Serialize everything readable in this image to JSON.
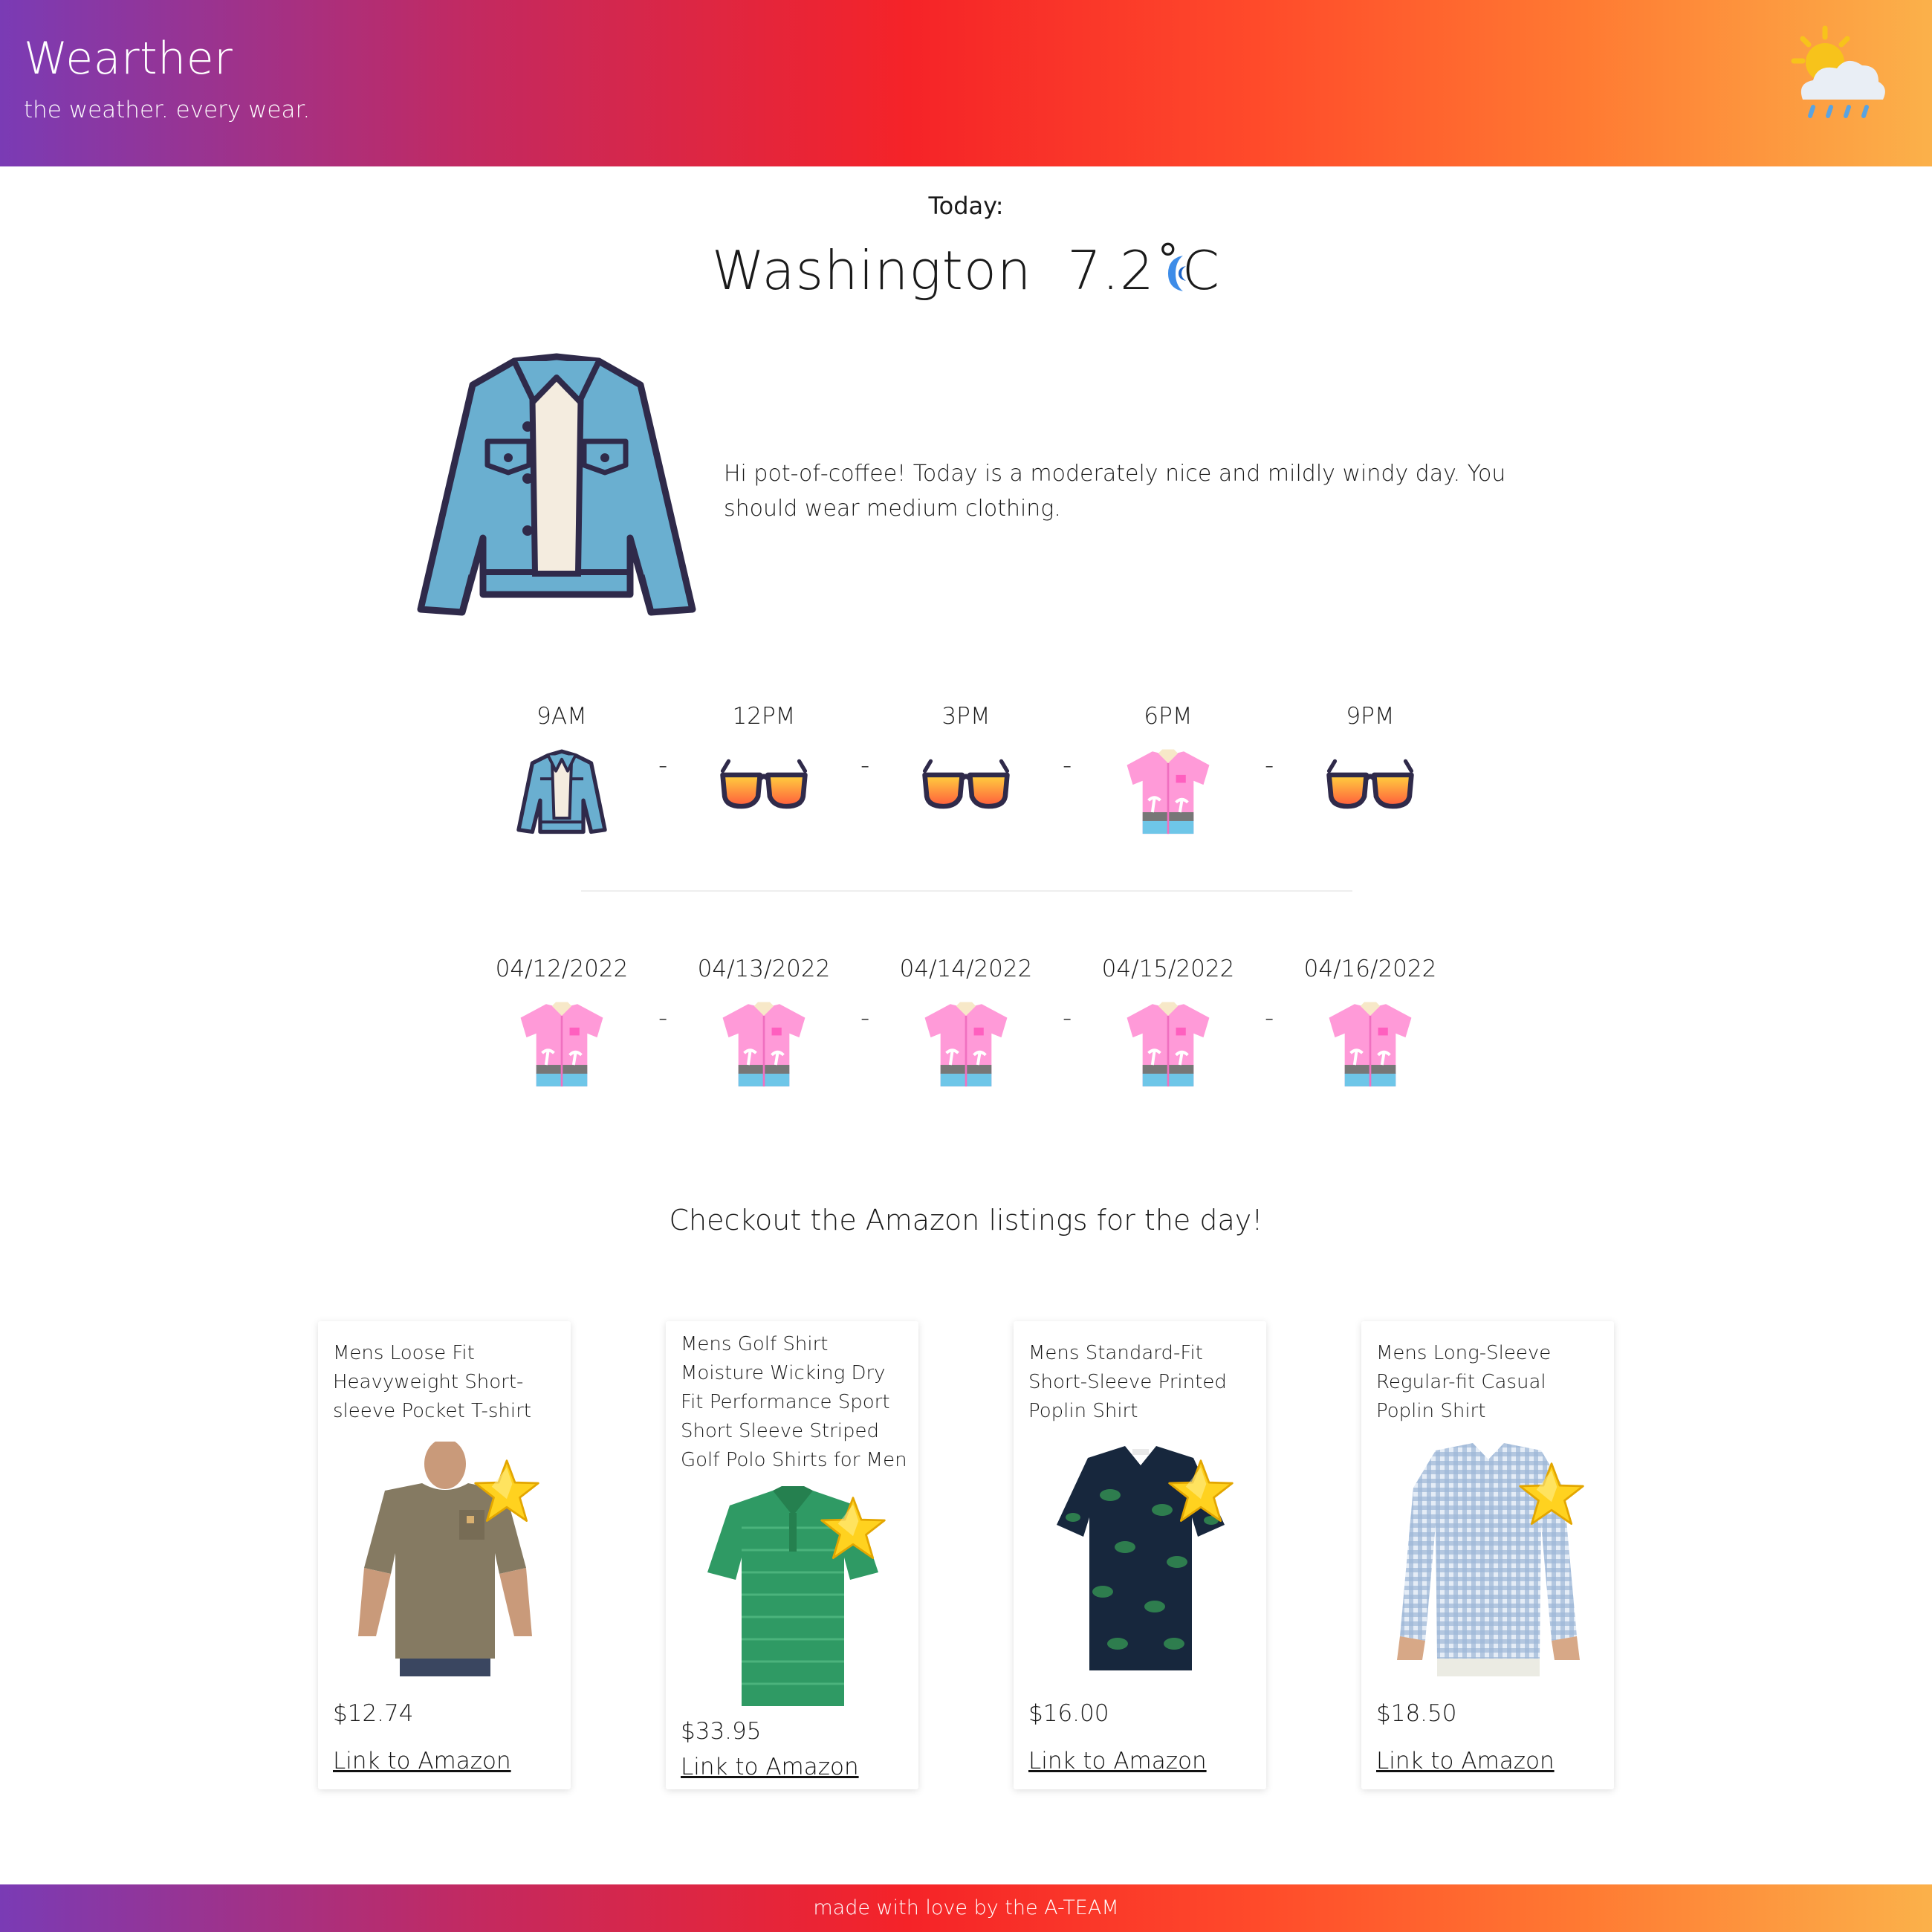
{
  "header": {
    "brand": "Wearther",
    "tagline": "the weather. every wear."
  },
  "today": {
    "label": "Today:",
    "city": "Washington",
    "temperature": "7.2˚C",
    "condition_icon": "moon-icon",
    "outfit_icon": "denim-jacket-icon",
    "message": "Hi pot-of-coffee! Today is a moderately nice and mildly windy day. You should wear medium clothing."
  },
  "hourly": [
    {
      "time": "9AM",
      "icon": "denim-jacket-icon"
    },
    {
      "time": "12PM",
      "icon": "sunglasses-icon"
    },
    {
      "time": "3PM",
      "icon": "sunglasses-icon"
    },
    {
      "time": "6PM",
      "icon": "hawaiian-shirt-icon"
    },
    {
      "time": "9PM",
      "icon": "sunglasses-icon"
    }
  ],
  "daily": [
    {
      "date": "04/12/2022",
      "icon": "hawaiian-shirt-icon"
    },
    {
      "date": "04/13/2022",
      "icon": "hawaiian-shirt-icon"
    },
    {
      "date": "04/14/2022",
      "icon": "hawaiian-shirt-icon"
    },
    {
      "date": "04/15/2022",
      "icon": "hawaiian-shirt-icon"
    },
    {
      "date": "04/16/2022",
      "icon": "hawaiian-shirt-icon"
    }
  ],
  "separator": "-",
  "amazon": {
    "heading": "Checkout the Amazon listings for the day!",
    "link_label": "Link to Amazon",
    "listings": [
      {
        "title": "Mens Loose Fit Heavyweight Short-sleeve Pocket T-shirt",
        "price": "$12.74",
        "image": "brown-tshirt-photo"
      },
      {
        "title": "Mens Golf Shirt Moisture Wicking Dry Fit Performance Sport Short Sleeve Striped Golf Polo Shirts for Men",
        "price": "$33.95",
        "image": "green-polo-photo"
      },
      {
        "title": "Mens Standard-Fit Short-Sleeve Printed Poplin Shirt",
        "price": "$16.00",
        "image": "floral-shirt-photo"
      },
      {
        "title": "Mens Long-Sleeve Regular-fit Casual Poplin Shirt",
        "price": "$18.50",
        "image": "gingham-shirt-photo"
      }
    ]
  },
  "footer": {
    "text": "made with love by the A-TEAM"
  },
  "colors": {
    "gradient": [
      "#7a3bb5",
      "#c4295f",
      "#f52328",
      "#ff4a2a",
      "#fbb14a"
    ],
    "denim": "#6aafd0",
    "shirt_pink": "#ff9ad8",
    "star": "#ffd21f"
  }
}
